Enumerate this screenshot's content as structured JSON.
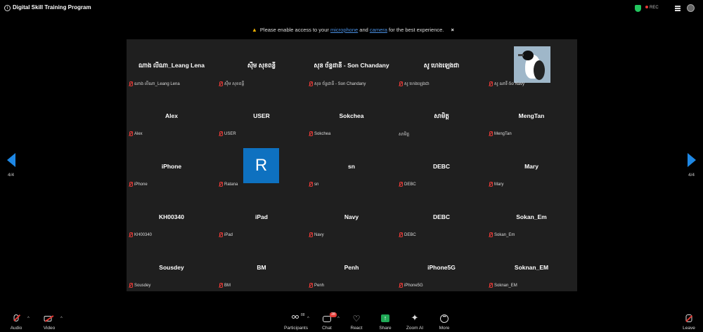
{
  "window": {
    "title": "Digital Skill Training Program",
    "rec_label": "REC"
  },
  "notice": {
    "prefix": "Please enable access to your",
    "link_mic": "microphone",
    "and": "and",
    "link_camera": "camera",
    "suffix": "for the best experience.",
    "close": "×"
  },
  "pagination": {
    "left": "4/4",
    "right": "4/4"
  },
  "tiles": [
    {
      "name": "ណាង លីណា_Leang Lena",
      "label": "ណាង លីណា_Leang Lena",
      "muted": true
    },
    {
      "name": "ស៊ឹម សុខពន្លឺ",
      "label": "ស៊ឹម សុខពន្លឺ",
      "muted": true
    },
    {
      "name": "សុន ច័ន្ទដានី - Son Chandany",
      "label": "សុន ច័ន្ទដានី - Son Chandany",
      "muted": true
    },
    {
      "name": "សូ ហេងឡេងជា",
      "label": "សូ ហេងឡេងជា",
      "muted": true
    },
    {
      "name": "",
      "label": "សូ ណាវី-So Navy",
      "muted": true,
      "picture": "bird"
    },
    {
      "name": "Alex",
      "label": "Alex",
      "muted": true
    },
    {
      "name": "USER",
      "label": "USER",
      "muted": true
    },
    {
      "name": "Sokchea",
      "label": "Sokchea",
      "muted": true
    },
    {
      "name": "សាមិត្ត",
      "label": "សាមិត្ត",
      "muted": false
    },
    {
      "name": "MengTan",
      "label": "MengTan",
      "muted": true
    },
    {
      "name": "iPhone",
      "label": "iPhone",
      "muted": true
    },
    {
      "name": "",
      "label": "Ratana",
      "muted": true,
      "avatar_letter": "R"
    },
    {
      "name": "sn",
      "label": "sn",
      "muted": true
    },
    {
      "name": "DEBC",
      "label": "DEBC",
      "muted": true
    },
    {
      "name": "Mary",
      "label": "Mary",
      "muted": true
    },
    {
      "name": "KH00340",
      "label": "KH00340",
      "muted": true
    },
    {
      "name": "iPad",
      "label": "iPad",
      "muted": true
    },
    {
      "name": "Navy",
      "label": "Navy",
      "muted": true
    },
    {
      "name": "DEBC",
      "label": "DEBC",
      "muted": true
    },
    {
      "name": "Sokan_Em",
      "label": "Sokan_Em",
      "muted": true
    },
    {
      "name": "Sousdey",
      "label": "Sousdey",
      "muted": true
    },
    {
      "name": "BM",
      "label": "BM",
      "muted": true
    },
    {
      "name": "Penh",
      "label": "Penh",
      "muted": true
    },
    {
      "name": "iPhone5G",
      "label": "iPhone5G",
      "muted": true
    },
    {
      "name": "Soknan_EM",
      "label": "Soknan_EM",
      "muted": true
    }
  ],
  "toolbar": {
    "audio": "Audio",
    "video": "Video",
    "participants": "Participants",
    "participants_count": "88",
    "chat": "Chat",
    "chat_badge": "28",
    "react": "React",
    "share": "Share",
    "zoom_ai": "Zoom AI",
    "more": "More",
    "leave": "Leave"
  },
  "colors": {
    "accent": "#1e88e5",
    "muted": "#e53935",
    "share": "#1fa855",
    "avatar": "#0e71c0",
    "tile_bg": "#1f1f1f"
  }
}
